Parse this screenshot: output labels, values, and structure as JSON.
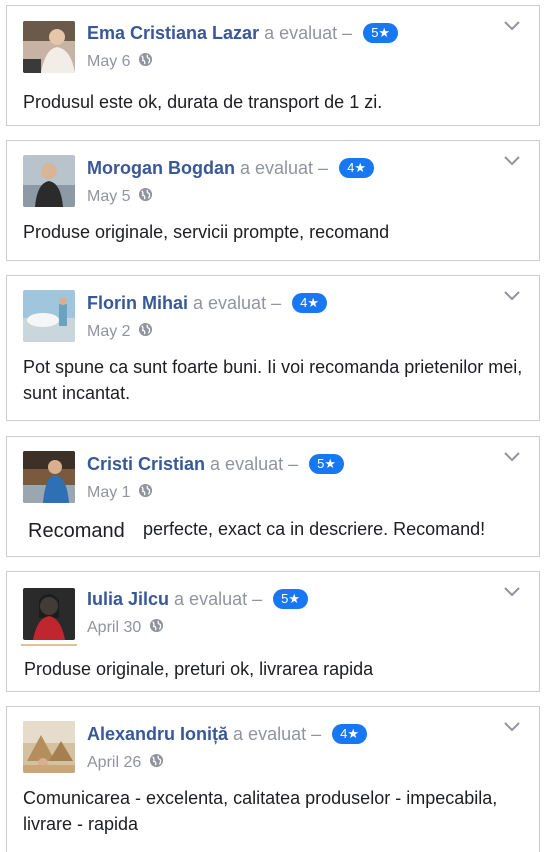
{
  "reviews": [
    {
      "name": "Ema Cristiana Lazar",
      "action": "a evaluat –",
      "rating": "5★",
      "date": "May 6",
      "text": "Produsul este ok, durata de transport de 1 zi."
    },
    {
      "name": "Morogan Bogdan",
      "action": "a evaluat –",
      "rating": "4★",
      "date": "May 5",
      "text": "Produse originale, servicii prompte, recomand"
    },
    {
      "name": "Florin Mihai",
      "action": "a evaluat –",
      "rating": "4★",
      "date": "May 2",
      "text": "Pot spune ca sunt foarte buni. Ii voi recomanda prietenilor mei, sunt incantat."
    },
    {
      "name": "Cristi Cristian",
      "action": "a evaluat –",
      "rating": "5★",
      "date": "May 1",
      "text": "perfecte, exact ca in descriere. Recomand!",
      "overlay_text": "Recomand"
    },
    {
      "name": "Iulia Jilcu",
      "action": "a evaluat –",
      "rating": "5★",
      "date": "April 30",
      "text": "Produse originale, preturi ok, livrarea rapida"
    },
    {
      "name": "Alexandru Ioniță",
      "action": "a evaluat –",
      "rating": "4★",
      "date": "April 26",
      "text": "Comunicarea - excelenta, calitatea produselor - impecabila, livrare - rapida"
    }
  ],
  "colors": {
    "name": "#385898",
    "meta": "#90949c",
    "badge": "#1877f2",
    "border": "#c9ccd1"
  },
  "icons": {
    "privacy": "globe-icon",
    "menu": "chevron-down-icon"
  }
}
